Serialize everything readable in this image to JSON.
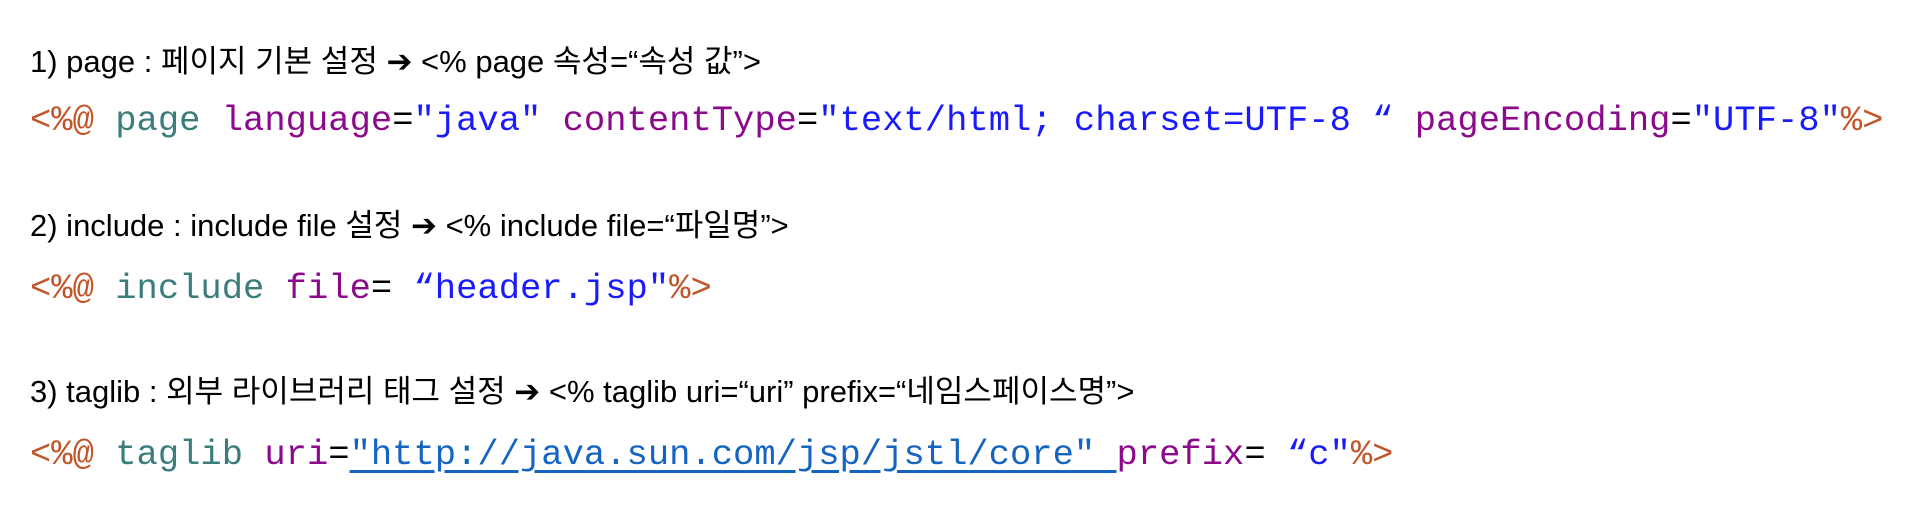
{
  "sections": [
    {
      "heading": "1) page : 페이지 기본 설정 ➔ <% page 속성=“속성 값”>",
      "code": [
        {
          "text": "<%@ ",
          "type": "delim"
        },
        {
          "text": "page ",
          "type": "dir"
        },
        {
          "text": "language",
          "type": "attr"
        },
        {
          "text": "=",
          "type": "eq"
        },
        {
          "text": "\"java\" ",
          "type": "str"
        },
        {
          "text": "contentType",
          "type": "attr"
        },
        {
          "text": "=",
          "type": "eq"
        },
        {
          "text": "\"text/html; charset=UTF-8 “ ",
          "type": "str"
        },
        {
          "text": "pageEncoding",
          "type": "attr"
        },
        {
          "text": "=",
          "type": "eq"
        },
        {
          "text": "\"UTF-8\"",
          "type": "str"
        },
        {
          "text": "%>",
          "type": "delim"
        }
      ]
    },
    {
      "heading": "2) include : include file 설정 ➔ <% include file=“파일명”>",
      "code": [
        {
          "text": "<%@ ",
          "type": "delim"
        },
        {
          "text": "include ",
          "type": "dir"
        },
        {
          "text": "file",
          "type": "attr"
        },
        {
          "text": "= ",
          "type": "eq"
        },
        {
          "text": "“header.jsp\"",
          "type": "str"
        },
        {
          "text": "%>",
          "type": "delim"
        }
      ]
    },
    {
      "heading": "3) taglib : 외부 라이브러리 태그 설정 ➔ <% taglib uri=“uri” prefix=“네임스페이스명”>",
      "code": [
        {
          "text": "<%@ ",
          "type": "delim"
        },
        {
          "text": "taglib ",
          "type": "dir"
        },
        {
          "text": "uri",
          "type": "attr"
        },
        {
          "text": "=",
          "type": "eq"
        },
        {
          "text": "\"http://java.sun.com/jsp/jstl/core\" ",
          "type": "link"
        },
        {
          "text": "prefix",
          "type": "attr"
        },
        {
          "text": "= ",
          "type": "eq"
        },
        {
          "text": "“c\"",
          "type": "str"
        },
        {
          "text": "%>",
          "type": "delim"
        }
      ]
    }
  ],
  "colors": {
    "delim": "#c0562a",
    "directive": "#3a7d7a",
    "attribute": "#8b0a8b",
    "string": "#1a1aff",
    "link": "#1565c0"
  }
}
